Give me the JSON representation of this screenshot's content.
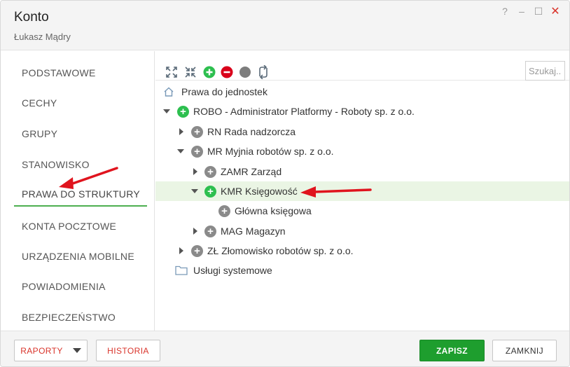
{
  "window": {
    "title": "Konto",
    "subtitle": "Łukasz Mądry",
    "controls": {
      "help": "?",
      "minimize": "–",
      "maximize": "☐",
      "close": "✕"
    }
  },
  "nav": {
    "items": [
      {
        "label": "PODSTAWOWE"
      },
      {
        "label": "CECHY"
      },
      {
        "label": "GRUPY"
      },
      {
        "label": "STANOWISKO"
      },
      {
        "label": "PRAWA DO STRUKTURY",
        "active": true
      },
      {
        "label": "KONTA POCZTOWE"
      },
      {
        "label": "URZĄDZENIA MOBILNE"
      },
      {
        "label": "POWIADOMIENIA"
      },
      {
        "label": "BEZPIECZEŃSTWO"
      }
    ]
  },
  "toolbar": {
    "icons": [
      "expand-all-icon",
      "collapse-all-icon",
      "add-icon",
      "remove-icon",
      "neutral-icon",
      "refresh-icon"
    ],
    "search_placeholder": "Szukaj..."
  },
  "tree": {
    "root_label": "Prawa do jednostek",
    "nodes": [
      {
        "label": "ROBO - Administrator Platformy - Roboty sp. z o.o.",
        "state": "expanded",
        "perm": "green"
      },
      {
        "label": "RN Rada nadzorcza",
        "state": "collapsed",
        "perm": "gray"
      },
      {
        "label": "MR Myjnia robotów sp. z o.o.",
        "state": "expanded",
        "perm": "gray"
      },
      {
        "label": "ZAMR Zarząd",
        "state": "collapsed",
        "perm": "gray"
      },
      {
        "label": "KMR Księgowość",
        "state": "expanded",
        "perm": "green",
        "selected": true
      },
      {
        "label": "Główna księgowa",
        "state": "leaf",
        "perm": "gray"
      },
      {
        "label": "MAG Magazyn",
        "state": "collapsed",
        "perm": "gray"
      },
      {
        "label": "ZŁ Złomowisko robotów sp. z o.o.",
        "state": "collapsed",
        "perm": "gray"
      }
    ],
    "system_label": "Usługi systemowe"
  },
  "footer": {
    "reports_label": "RAPORTY",
    "history_label": "HISTORIA",
    "save_label": "ZAPISZ",
    "close_label": "ZAMKNIJ"
  },
  "colors": {
    "accent_green": "#1e9e2e",
    "perm_green": "#2dbf4f",
    "perm_gray": "#8a8a8a",
    "remove_red": "#d9001b",
    "annotation_red": "#e0141e",
    "selected_row": "#eaf5e4"
  }
}
